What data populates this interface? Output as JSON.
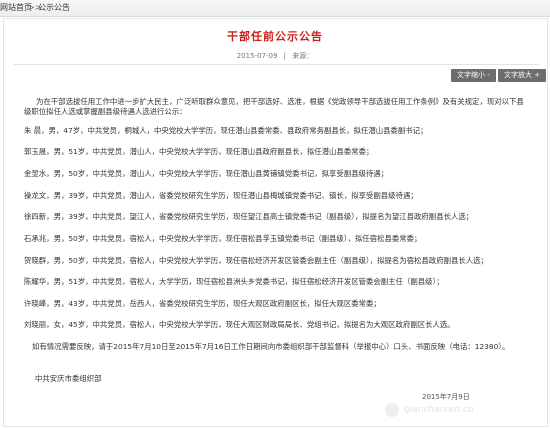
{
  "breadcrumb": {
    "home": "网站首页",
    "separator": ">>",
    "current": "公示公告"
  },
  "article": {
    "title": "干部任前公示公告",
    "date": "2015-07-09",
    "divider": "|",
    "source_label": "来源："
  },
  "toolbar": {
    "shrink_label": "文字缩小 -",
    "enlarge_label": "文字放大 +"
  },
  "content": {
    "intro": [
      "为在干部选拔任用工作中进一步扩大民主，广泛听取群众意见，把干部选好、选准，根据《党政领导干部选拔任用工作条例》及有关规定，现对以下县",
      "级职位拟任人选或掌握副县级待遇人选进行公示："
    ],
    "candidates": [
      "朱    晨，男，47岁，中共党员，桐城人，中央党校大学学历，现任潜山县委常委、县政府常务副县长，拟任潜山县委副书记；",
      "郭玉晟，男，51岁，中共党员，潜山人，中央党校大学学历，现任潜山县政府副县长，拟任潜山县委常委；",
      "金显水，男，50岁，中共党员，潜山人，中央党校大学学历，现任潜山县黄铺镇党委书记，拟享受副县级待遇；",
      "操龙文，男，39岁，中共党员，潜山人，省委党校研究生学历，现任潜山县梅城镇党委书记、镇长，拟享受副县级待遇；",
      "徐四新，男，39岁，中共党员，望江人，省委党校研究生学历，现任望江县高士镇党委书记（副县级），拟提名为望江县政府副县长人选；",
      "石承兆，男，50岁，中共党员，宿松人，中央党校大学学历，现任宿松县孚玉镇党委书记（副县级），拟任宿松县委常委；",
      "贺晓群，男，50岁，中共党员，宿松人，中央党校大学学历，现任宿松经济开发区管委会副主任（副县级），拟提名为宿松县政府副县长人选；",
      "陈耀华，男，51岁，中共党员，宿松人，大学学历，现任宿松县洲头乡党委书记，拟任宿松经济开发区管委会副主任（副县级）；",
      "许晓峰，男，43岁，中共党员，岳西人，省委党校研究生学历，现任大观区政府副区长，拟任大观区委常委；",
      "刘晓丽，女，45岁，中共党员，宿松人，中央党校大学学历，现任大观区财政局局长、党组书记，拟提名为大观区政府副区长人选。"
    ],
    "feedback": "如有情况需要反映，请于2015年7月10日至2015年7月16日工作日期间向市委组织部干部监督科（举报中心）口头、书面反映（电话：12380）。",
    "signature": "中共安庆市委组织部",
    "sign_date": "2015年7月9日"
  },
  "watermark": "qianshanren.cn",
  "colors": {
    "title": "#c8201c",
    "button_bg": "#6d6d6d"
  }
}
